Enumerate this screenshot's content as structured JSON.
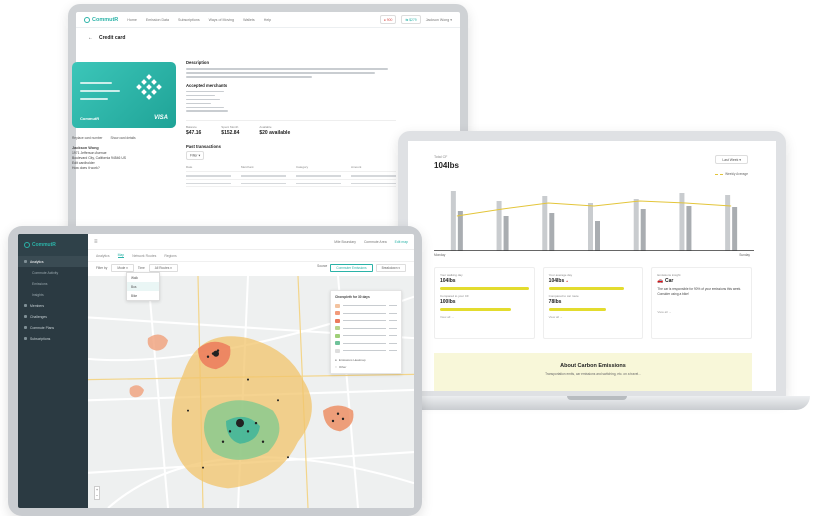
{
  "monitor": {
    "brand": "CommutR",
    "nav": [
      "Home",
      "Emission Data",
      "Subscriptions",
      "Ways of Moving",
      "Wallets",
      "Help"
    ],
    "badge_red": "● 900",
    "badge_teal": "⇆ $279",
    "user": "Jackson Wong ▾",
    "page_title": "Credit card",
    "card_brand": "CommutR",
    "card_visa": "VISA",
    "link_replace": "Replace card number",
    "link_show": "Show card details",
    "holder_name": "Jackson Wong",
    "holder_street": "1971 Jefferson Avenue",
    "holder_city": "Boulevard City, California 94546 US",
    "link_edit": "Edit cardholder",
    "link_help": "How does it work?",
    "section_description": "Description",
    "section_accepted": "Accepted merchants",
    "stats": [
      {
        "label": "Balance",
        "value": "$47.16"
      },
      {
        "label": "Spent Month",
        "value": "$152.84"
      },
      {
        "label": "Available",
        "value": "$20 available"
      }
    ],
    "section_transactions": "Past transactions",
    "filter_label": "Filter ▾",
    "table_cols": [
      "Date",
      "Merchant",
      "Category",
      "Amount"
    ]
  },
  "laptop": {
    "top_label": "Total CF",
    "value": "104lbs",
    "select": "Last Week ▾",
    "legend": "Weekly Average",
    "x_start": "Monday",
    "x_end": "Sunday",
    "metrics": [
      {
        "label": "Your walking day",
        "value": "104lbs",
        "fill": 1.0
      },
      {
        "label": "Your average day",
        "value": "104lbs",
        "fill": 0.85
      },
      {
        "label": "Emissions insight",
        "value": "Car"
      }
    ],
    "metrics_b": [
      {
        "label": "Compared to your CF",
        "value": "100lbs",
        "fill": 0.8
      },
      {
        "label": "Compared to car route",
        "value": "78lbs",
        "fill": 0.65
      }
    ],
    "insight_text": "The car is responsible for 90% of your emissions this week. Consider using a bike!",
    "more": "View all →",
    "about_title": "About Carbon Emissions",
    "about_sub": "Transportation emits, car emissions and switching, etc. on a travel..."
  },
  "tablet": {
    "brand": "CommutR",
    "sidebar": [
      "Analytics",
      "Commute Activity",
      "Emissions",
      "Insights",
      "Members",
      "Challenges",
      "Commute Plans",
      "Subscriptions"
    ],
    "topbar_right": [
      "Mile Boundary",
      "Commute Area",
      "Edit map"
    ],
    "tabs": [
      "Analytics",
      "Map",
      "Network Routes",
      "Regions"
    ],
    "filter_label": "Filter by",
    "filter_value": "Mode ▾",
    "time_label": "Time",
    "time_value": "All Routes ▾",
    "right_label": "Source",
    "right_btn1": "Commuter Emissions",
    "right_btn2": "Breakdown ▾",
    "dropdown": [
      "Walk",
      "Bus",
      "Bike",
      "Train"
    ],
    "legend_title": "Choropleth for 30 days",
    "legend_colors": [
      "#f3c3a0",
      "#f29a7a",
      "#ec7a5c",
      "#b7d38a",
      "#9fcf78",
      "#6fc29a",
      "#ddd"
    ],
    "legend_foot1": "Emissions Heatmap",
    "legend_foot2": "Other",
    "zoom_in": "+",
    "zoom_out": "−"
  },
  "colors": {
    "accent": "#2bb3a8",
    "yellow": "#e3dc2e",
    "sidebar": "#2b3a42"
  },
  "chart_data": {
    "type": "bar",
    "categories": [
      "Monday",
      "",
      "",
      "",
      "",
      "",
      "Sunday"
    ],
    "series": [
      {
        "values": [
          60,
          50,
          55,
          48,
          52,
          58,
          56
        ]
      },
      {
        "values": [
          40,
          35,
          38,
          30,
          42,
          45,
          44
        ]
      }
    ],
    "line": [
      35,
      42,
      48,
      45,
      50,
      48,
      45
    ],
    "ylim": [
      0,
      70
    ]
  }
}
